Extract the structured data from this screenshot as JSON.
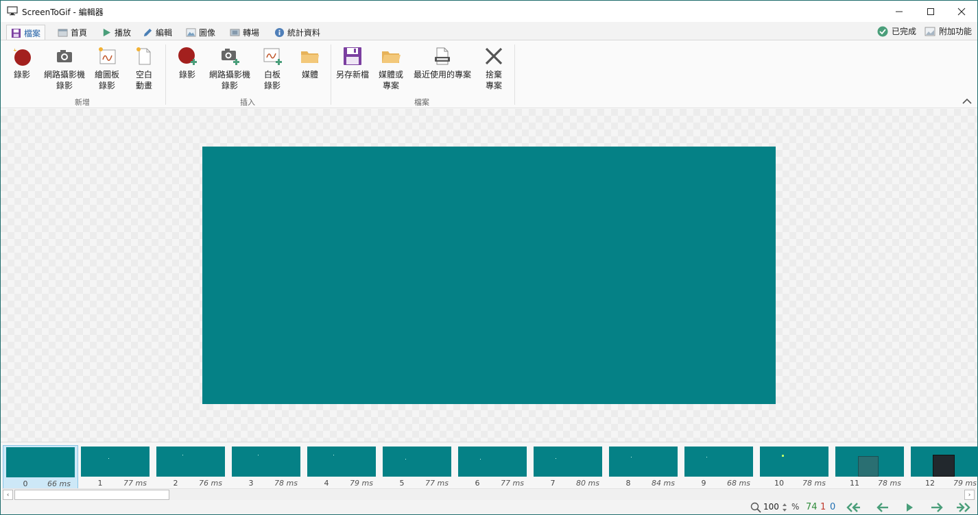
{
  "window": {
    "title": "ScreenToGif - 編輯器",
    "controls": [
      "minimize-icon",
      "maximize-icon",
      "close-icon"
    ]
  },
  "tabs": [
    {
      "label": "檔案",
      "icon": "floppy-icon",
      "active": true
    },
    {
      "label": "首頁",
      "icon": "home-icon"
    },
    {
      "label": "播放",
      "icon": "play-icon"
    },
    {
      "label": "編輯",
      "icon": "pencil-icon"
    },
    {
      "label": "圖像",
      "icon": "image-icon"
    },
    {
      "label": "轉場",
      "icon": "transition-icon"
    },
    {
      "label": "統計資料",
      "icon": "info-icon"
    }
  ],
  "tab_right": {
    "done_label": "已完成",
    "extras_label": "附加功能"
  },
  "ribbon": {
    "groups": [
      {
        "label": "新增",
        "buttons": [
          {
            "line1": "錄影",
            "line2": "",
            "icon": "record-icon"
          },
          {
            "line1": "網路攝影機",
            "line2": "錄影",
            "icon": "webcam-icon"
          },
          {
            "line1": "繪圖板",
            "line2": "錄影",
            "icon": "board-icon"
          },
          {
            "line1": "空白",
            "line2": "動畫",
            "icon": "blank-file-icon"
          }
        ]
      },
      {
        "label": "插入",
        "buttons": [
          {
            "line1": "錄影",
            "line2": "",
            "icon": "record-add-icon"
          },
          {
            "line1": "網路攝影機",
            "line2": "錄影",
            "icon": "webcam-add-icon"
          },
          {
            "line1": "白板",
            "line2": "錄影",
            "icon": "board-add-icon"
          },
          {
            "line1": "媒體",
            "line2": "",
            "icon": "folder-icon"
          }
        ]
      },
      {
        "label": "檔案",
        "buttons": [
          {
            "line1": "另存新檔",
            "line2": "",
            "icon": "save-as-icon"
          },
          {
            "line1": "媒體或",
            "line2": "專案",
            "icon": "open-folder-icon"
          },
          {
            "line1": "最近使用的專案",
            "line2": "",
            "icon": "recent-file-icon"
          },
          {
            "line1": "捨棄",
            "line2": "專案",
            "icon": "discard-icon"
          }
        ]
      }
    ]
  },
  "canvas": {
    "frame_color": "#058186"
  },
  "frames": [
    {
      "index": "0",
      "ms": "66 ms"
    },
    {
      "index": "1",
      "ms": "77 ms"
    },
    {
      "index": "2",
      "ms": "76 ms"
    },
    {
      "index": "3",
      "ms": "78 ms"
    },
    {
      "index": "4",
      "ms": "79 ms"
    },
    {
      "index": "5",
      "ms": "77 ms"
    },
    {
      "index": "6",
      "ms": "77 ms"
    },
    {
      "index": "7",
      "ms": "80 ms"
    },
    {
      "index": "8",
      "ms": "84 ms"
    },
    {
      "index": "9",
      "ms": "68 ms"
    },
    {
      "index": "10",
      "ms": "78 ms"
    },
    {
      "index": "11",
      "ms": "78 ms"
    },
    {
      "index": "12",
      "ms": "79 ms"
    }
  ],
  "status": {
    "zoom_value": "100",
    "zoom_unit": "%",
    "total_frames": "74",
    "selected_count": "1",
    "current_frame": "0",
    "colors": {
      "green": "#2e8b3a",
      "red": "#c0392b",
      "blue": "#1f6fb2"
    }
  }
}
